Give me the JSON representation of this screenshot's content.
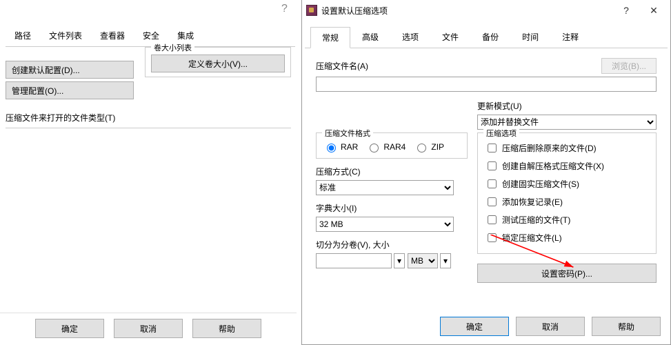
{
  "bg": {
    "tabs": [
      "路径",
      "文件列表",
      "查看器",
      "安全",
      "集成"
    ],
    "vol_group": "卷大小列表",
    "define_vol": "定义卷大小(V)...",
    "create_default": "创建默认配置(D)...",
    "manage_config": "管理配置(O)...",
    "filetype_label": "压缩文件来打开的文件类型(T)",
    "ok": "确定",
    "cancel": "取消",
    "help": "帮助"
  },
  "dlg": {
    "title": "设置默认压缩选项",
    "tabs": [
      "常规",
      "高级",
      "选项",
      "文件",
      "备份",
      "时间",
      "注释"
    ],
    "archive_name": "压缩文件名(A)",
    "browse": "浏览(B)...",
    "update_mode": "更新模式(U)",
    "update_value": "添加并替换文件",
    "format_group": "压缩文件格式",
    "formats": [
      "RAR",
      "RAR4",
      "ZIP"
    ],
    "method": "压缩方式(C)",
    "method_value": "标准",
    "dict": "字典大小(I)",
    "dict_value": "32 MB",
    "split_label": "切分为分卷(V), 大小",
    "split_unit": "MB",
    "opts_group": "压缩选项",
    "opts": [
      "压缩后删除原来的文件(D)",
      "创建自解压格式压缩文件(X)",
      "创建固实压缩文件(S)",
      "添加恢复记录(E)",
      "测试压缩的文件(T)",
      "锁定压缩文件(L)"
    ],
    "set_pwd": "设置密码(P)...",
    "ok": "确定",
    "cancel": "取消",
    "help": "帮助"
  }
}
